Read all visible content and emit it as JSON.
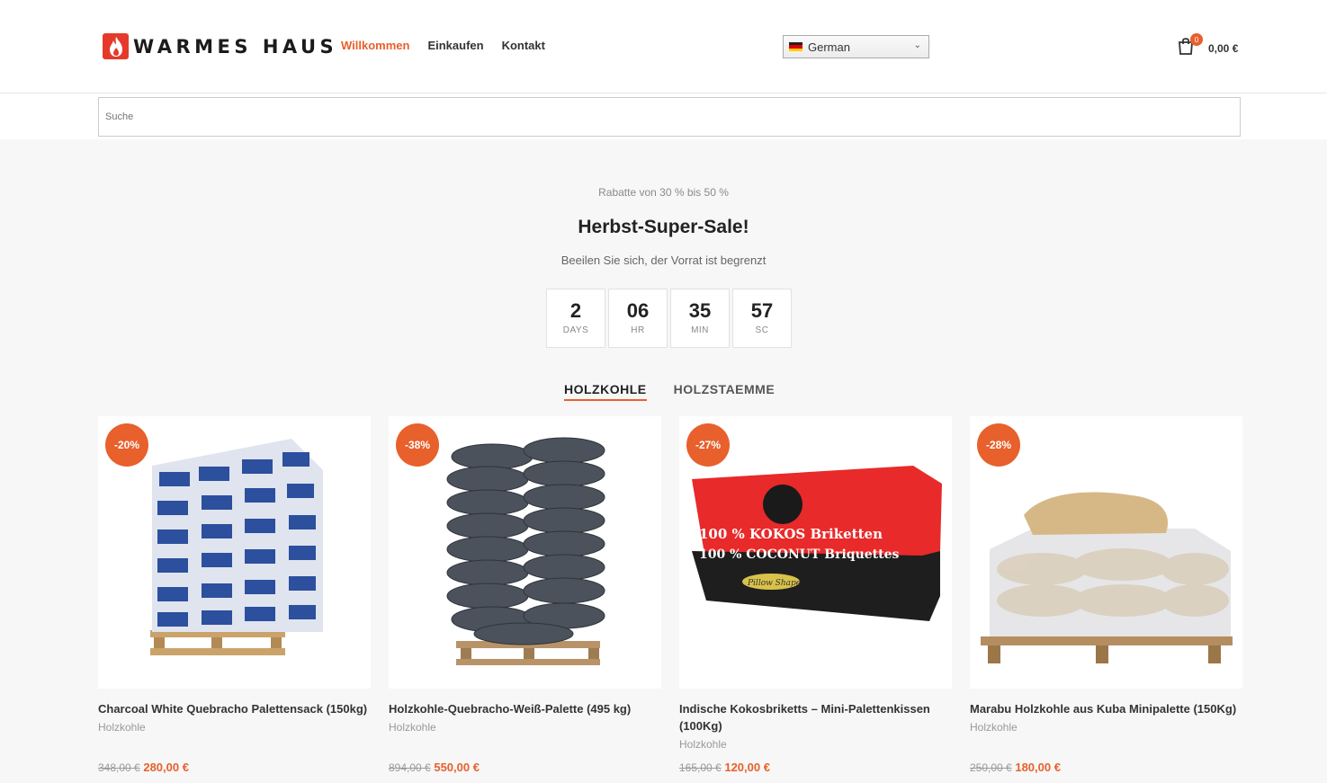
{
  "brand": {
    "name": "WARMES HAUS",
    "accent": "#e8602c",
    "logo_color": "#e53a2b"
  },
  "nav": {
    "items": [
      {
        "label": "Willkommen",
        "active": true
      },
      {
        "label": "Einkaufen",
        "active": false
      },
      {
        "label": "Kontakt",
        "active": false
      }
    ]
  },
  "language": {
    "selected": "German",
    "icon": "flag-de-icon"
  },
  "cart": {
    "count": "0",
    "total": "0,00 €",
    "icon": "shopping-bag-icon"
  },
  "search": {
    "placeholder": "Suche"
  },
  "promo": {
    "subtitle": "Rabatte von 30 % bis 50 %",
    "title": "Herbst-Super-Sale!",
    "description": "Beeilen Sie sich, der Vorrat ist begrenzt"
  },
  "countdown": [
    {
      "value": "2",
      "label": "DAYS"
    },
    {
      "value": "06",
      "label": "HR"
    },
    {
      "value": "35",
      "label": "MIN"
    },
    {
      "value": "57",
      "label": "SC"
    }
  ],
  "tabs": [
    {
      "label": "HOLZKOHLE",
      "active": true
    },
    {
      "label": "HOLZSTAEMME",
      "active": false
    }
  ],
  "products": [
    {
      "badge": "-20%",
      "name": "Charcoal White Quebracho Palettensack (150kg)",
      "category": "Holzkohle",
      "old_price": "348,00 €",
      "price": "280,00 €",
      "image": "palette-blue-bags"
    },
    {
      "badge": "-38%",
      "name": "Holzkohle-Quebracho-Weiß-Palette (495 kg)",
      "category": "Holzkohle",
      "old_price": "894,00 €",
      "price": "550,00 €",
      "image": "palette-dark-bags"
    },
    {
      "badge": "-27%",
      "name": "Indische Kokosbriketts – Mini-Palettenkissen (100Kg)",
      "category": "Holzkohle",
      "old_price": "165,00 €",
      "price": "120,00 €",
      "image": "kokos-briketten-box",
      "box_text": [
        "100 % KOKOS Briketten",
        "100 % COCONUT Briquettes",
        "Pillow Shape"
      ]
    },
    {
      "badge": "-28%",
      "name": "Marabu Holzkohle aus Kuba Minipalette (150Kg)",
      "category": "Holzkohle",
      "old_price": "250,00 €",
      "price": "180,00 €",
      "image": "palette-wrapped-bags"
    }
  ]
}
